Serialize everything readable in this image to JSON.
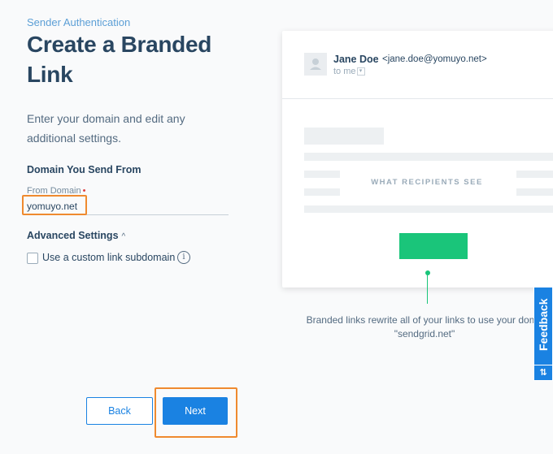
{
  "header": {
    "breadcrumb": "Sender Authentication",
    "title": "Create a Branded Link",
    "description": "Enter your domain and edit any additional settings."
  },
  "form": {
    "section_label": "Domain You Send From",
    "from_domain_label": "From Domain",
    "required_marker": "•",
    "from_domain_value": "yomuyo.net",
    "advanced_settings_label": "Advanced Settings",
    "advanced_chevron": "^",
    "custom_subdomain_label": "Use a custom link subdomain",
    "custom_subdomain_checked": false,
    "info_icon": "i"
  },
  "buttons": {
    "back_label": "Back",
    "next_label": "Next"
  },
  "preview": {
    "sender_name": "Jane Doe",
    "sender_email": "<jane.doe@yomuyo.net>",
    "to_label": "to me",
    "placeholder_label": "WHAT RECIPIENTS SEE",
    "caption_line1": "Branded links rewrite all of your links to use your doma",
    "caption_line2": "\"sendgrid.net\""
  },
  "feedback": {
    "label": "Feedback",
    "icon_glyph": "⇅"
  },
  "colors": {
    "accent": "#1a82e2",
    "highlight": "#ef8a2f",
    "cta_green": "#1ac57a",
    "heading": "#294661"
  }
}
